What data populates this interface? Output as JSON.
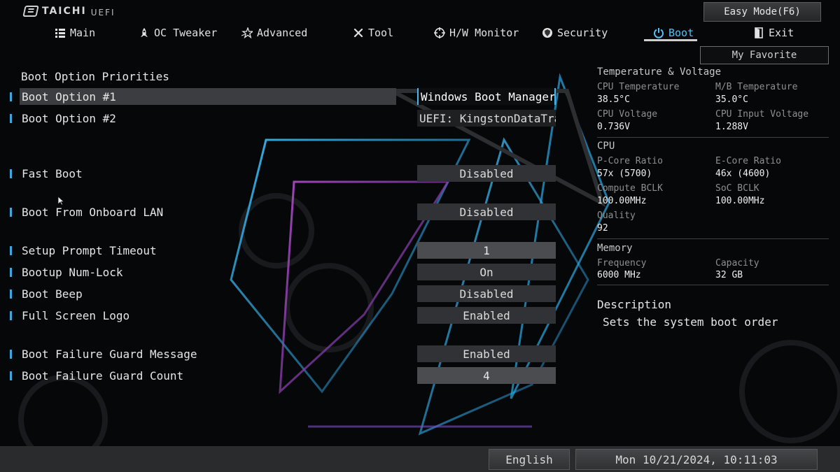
{
  "brand": {
    "name": "TAICHI",
    "sub": "UEFI"
  },
  "header": {
    "easy_mode_label": "Easy Mode(F6)",
    "my_favorite_label": "My Favorite"
  },
  "nav": [
    {
      "label": "Main",
      "icon": "list-icon"
    },
    {
      "label": "OC Tweaker",
      "icon": "rocket-icon"
    },
    {
      "label": "Advanced",
      "icon": "star-icon"
    },
    {
      "label": "Tool",
      "icon": "tools-icon"
    },
    {
      "label": "H/W Monitor",
      "icon": "crosshair-icon"
    },
    {
      "label": "Security",
      "icon": "shield-icon"
    },
    {
      "label": "Boot",
      "icon": "power-icon",
      "active": true
    },
    {
      "label": "Exit",
      "icon": "exit-door-icon"
    }
  ],
  "settings": {
    "section_title": "Boot Option Priorities",
    "rows": [
      {
        "label": "Boot Option #1",
        "value": "Windows Boot Manager ...",
        "selected": true
      },
      {
        "label": "Boot Option #2",
        "value": "UEFI: KingstonDataTra..."
      },
      {
        "label": "Fast Boot",
        "value": "Disabled"
      },
      {
        "label": "Boot From Onboard LAN",
        "value": "Disabled"
      },
      {
        "label": "Setup Prompt Timeout",
        "value": "1"
      },
      {
        "label": "Bootup Num-Lock",
        "value": "On"
      },
      {
        "label": "Boot Beep",
        "value": "Disabled"
      },
      {
        "label": "Full Screen Logo",
        "value": "Enabled"
      },
      {
        "label": "Boot Failure Guard Message",
        "value": "Enabled"
      },
      {
        "label": "Boot Failure Guard Count",
        "value": "4"
      }
    ]
  },
  "monitor": {
    "temp_voltage": {
      "title": "Temperature & Voltage",
      "cpu_temp_label": "CPU Temperature",
      "cpu_temp_value": "38.5°C",
      "mb_temp_label": "M/B Temperature",
      "mb_temp_value": "35.0°C",
      "cpu_voltage_label": "CPU Voltage",
      "cpu_voltage_value": "0.736V",
      "cpu_input_voltage_label": "CPU Input Voltage",
      "cpu_input_voltage_value": "1.288V"
    },
    "cpu": {
      "title": "CPU",
      "pcore_label": "P-Core Ratio",
      "pcore_value": "57x (5700)",
      "ecore_label": "E-Core Ratio",
      "ecore_value": "46x (4600)",
      "compute_bclk_label": "Compute BCLK",
      "compute_bclk_value": "100.00MHz",
      "soc_bclk_label": "SoC BCLK",
      "soc_bclk_value": "100.00MHz",
      "quality_label": "Quality",
      "quality_value": "92"
    },
    "memory": {
      "title": "Memory",
      "freq_label": "Frequency",
      "freq_value": "6000 MHz",
      "capacity_label": "Capacity",
      "capacity_value": "32 GB"
    }
  },
  "description": {
    "title": "Description",
    "text": "Sets the system boot order"
  },
  "footer": {
    "language": "English",
    "datetime": "Mon 10/21/2024, 10:11:03"
  },
  "colors": {
    "accent": "#4fc3f7",
    "marker": "#3fa7df",
    "glow_pink": "#c04fd8"
  }
}
